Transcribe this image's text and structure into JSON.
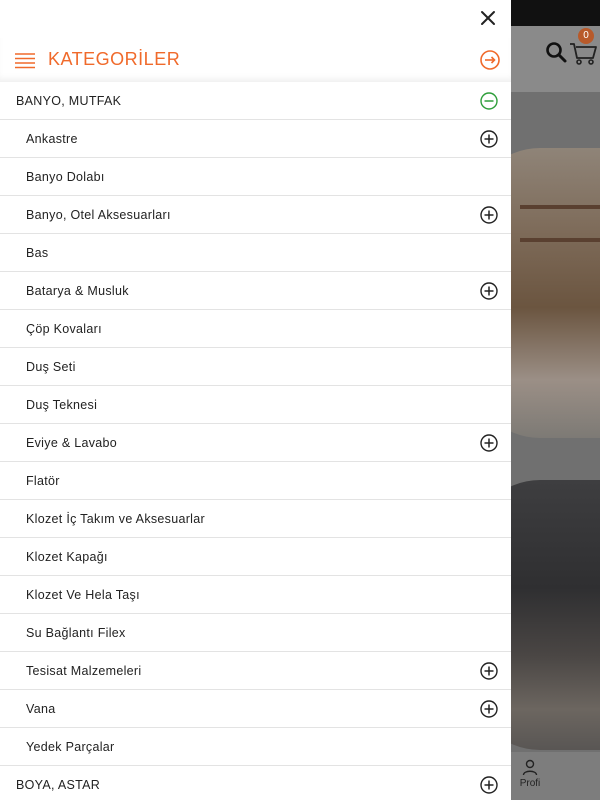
{
  "background": {
    "cart_badge": "0",
    "profile_label": "Profi"
  },
  "drawer": {
    "title": "KATEGORİLER",
    "accent_color": "#f06a2b",
    "expanded_color": "#2e9e3a",
    "rows": [
      {
        "label": "BANYO, MUTFAK",
        "level": "top",
        "icon": "minus-circle-icon"
      },
      {
        "label": "Ankastre",
        "level": "sub",
        "icon": "plus-circle-icon"
      },
      {
        "label": "Banyo Dolabı",
        "level": "sub",
        "icon": ""
      },
      {
        "label": "Banyo, Otel Aksesuarları",
        "level": "sub",
        "icon": "plus-circle-icon"
      },
      {
        "label": "Bas",
        "level": "sub",
        "icon": ""
      },
      {
        "label": "Batarya & Musluk",
        "level": "sub",
        "icon": "plus-circle-icon"
      },
      {
        "label": "Çöp Kovaları",
        "level": "sub",
        "icon": ""
      },
      {
        "label": "Duş Seti",
        "level": "sub",
        "icon": ""
      },
      {
        "label": "Duş Teknesi",
        "level": "sub",
        "icon": ""
      },
      {
        "label": "Eviye & Lavabo",
        "level": "sub",
        "icon": "plus-circle-icon"
      },
      {
        "label": "Flatör",
        "level": "sub",
        "icon": ""
      },
      {
        "label": "Klozet İç Takım ve Aksesuarlar",
        "level": "sub",
        "icon": ""
      },
      {
        "label": "Klozet Kapağı",
        "level": "sub",
        "icon": ""
      },
      {
        "label": "Klozet Ve Hela Taşı",
        "level": "sub",
        "icon": ""
      },
      {
        "label": "Su Bağlantı Filex",
        "level": "sub",
        "icon": ""
      },
      {
        "label": "Tesisat Malzemeleri",
        "level": "sub",
        "icon": "plus-circle-icon"
      },
      {
        "label": "Vana",
        "level": "sub",
        "icon": "plus-circle-icon"
      },
      {
        "label": "Yedek Parçalar",
        "level": "sub",
        "icon": ""
      },
      {
        "label": "BOYA, ASTAR",
        "level": "top",
        "icon": "plus-circle-icon"
      }
    ]
  }
}
